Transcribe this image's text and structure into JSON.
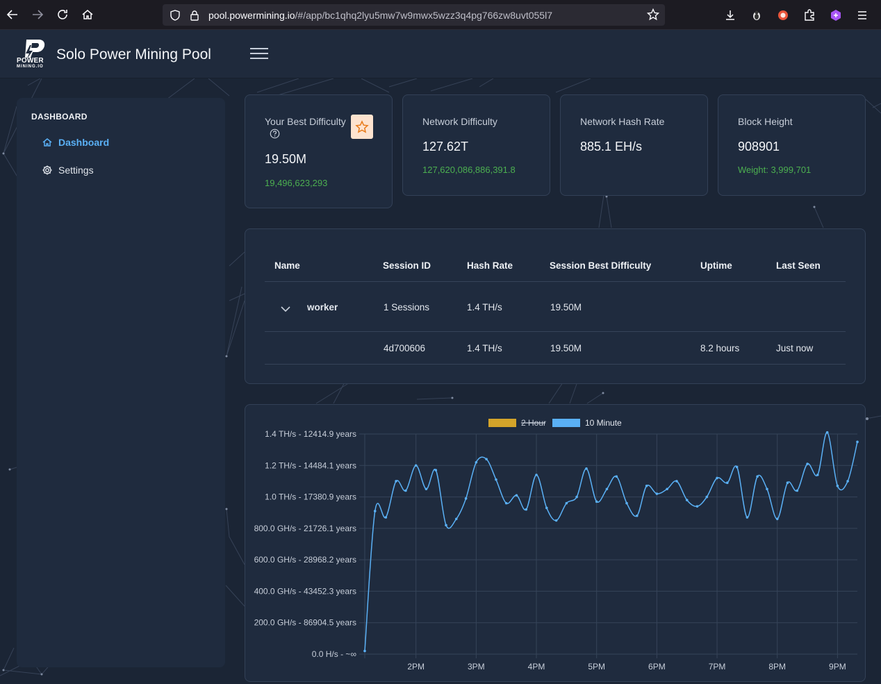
{
  "browser": {
    "url_host": "pool.powermining.io",
    "url_path": "/#/app/bc1qhq2lyu5mw7w9mwx5wzz3q4pg766zw8uvt055l7"
  },
  "header": {
    "logo_word": "POWER",
    "logo_sub": "MINING.IO",
    "title": "Solo Power Mining Pool"
  },
  "sidebar": {
    "heading": "DASHBOARD",
    "items": [
      {
        "label": "Dashboard",
        "icon": "home-icon",
        "active": true
      },
      {
        "label": "Settings",
        "icon": "gear-icon",
        "active": false
      }
    ]
  },
  "cards": [
    {
      "label": "Your Best Difficulty",
      "value": "19.50M",
      "sub": "19,496,623,293"
    },
    {
      "label": "Network Difficulty",
      "value": "127.62T",
      "sub": "127,620,086,886,391.8"
    },
    {
      "label": "Network Hash Rate",
      "value": "885.1 EH/s",
      "sub": ""
    },
    {
      "label": "Block Height",
      "value": "908901",
      "sub": "Weight: 3,999,701"
    }
  ],
  "table": {
    "headers": [
      "Name",
      "Session ID",
      "Hash Rate",
      "Session Best Difficulty",
      "Uptime",
      "Last Seen"
    ],
    "group_row": {
      "name": "worker",
      "session": "1 Sessions",
      "hashrate": "1.4 TH/s",
      "best": "19.50M"
    },
    "session_row": {
      "session": "4d700606",
      "hashrate": "1.4 TH/s",
      "best": "19.50M",
      "uptime": "8.2 hours",
      "last_seen": "Just now"
    }
  },
  "colors": {
    "accent": "#5ab0f5",
    "positive": "#4caf50",
    "series_2hour": "#d4a42a",
    "series_10min": "#5ab0f5"
  },
  "chart_data": {
    "type": "line",
    "legend_placement": "top",
    "series_legend": [
      {
        "name": "2 Hour",
        "hidden": true
      },
      {
        "name": "10 Minute",
        "hidden": false
      }
    ],
    "y_tick_labels": [
      "1.4 TH/s - 12414.9 years",
      "1.2 TH/s - 14484.1 years",
      "1.0 TH/s - 17380.9 years",
      "800.0 GH/s - 21726.1 years",
      "600.0 GH/s - 28968.2 years",
      "400.0 GH/s - 43452.3 years",
      "200.0 GH/s - 86904.5 years",
      "0.0 H/s - ~∞"
    ],
    "y_tick_values": [
      1.4,
      1.2,
      1.0,
      0.8,
      0.6,
      0.4,
      0.2,
      0.0
    ],
    "ylim": [
      0,
      1.4
    ],
    "x_tick_labels": [
      "2PM",
      "3PM",
      "4PM",
      "5PM",
      "6PM",
      "7PM",
      "8PM",
      "9PM"
    ],
    "x_tick_hours": [
      14,
      15,
      16,
      17,
      18,
      19,
      20,
      21
    ],
    "xlim": [
      13.15,
      21.33
    ],
    "grid": true,
    "series": [
      {
        "name": "10 Minute",
        "x_hours": [
          13.15,
          13.32,
          13.5,
          13.67,
          13.83,
          14.0,
          14.17,
          14.33,
          14.5,
          14.67,
          14.83,
          15.0,
          15.17,
          15.33,
          15.5,
          15.67,
          15.83,
          16.0,
          16.17,
          16.33,
          16.5,
          16.67,
          16.83,
          17.0,
          17.17,
          17.33,
          17.5,
          17.67,
          17.83,
          18.0,
          18.17,
          18.33,
          18.5,
          18.67,
          18.83,
          19.0,
          19.17,
          19.33,
          19.5,
          19.67,
          19.83,
          20.0,
          20.17,
          20.33,
          20.5,
          20.67,
          20.83,
          21.0,
          21.17,
          21.33
        ],
        "values": [
          0.02,
          0.91,
          0.87,
          1.1,
          1.04,
          1.2,
          1.05,
          1.17,
          0.82,
          0.86,
          0.99,
          1.22,
          1.24,
          1.11,
          0.96,
          1.01,
          0.92,
          1.14,
          0.93,
          0.85,
          0.96,
          1.0,
          1.18,
          0.97,
          1.05,
          1.13,
          0.96,
          0.88,
          1.07,
          1.02,
          1.05,
          1.1,
          0.98,
          0.94,
          1.0,
          1.12,
          1.09,
          1.19,
          0.87,
          1.13,
          1.05,
          0.86,
          1.09,
          1.04,
          1.21,
          1.14,
          1.41,
          1.07,
          1.1,
          1.35
        ]
      }
    ]
  }
}
